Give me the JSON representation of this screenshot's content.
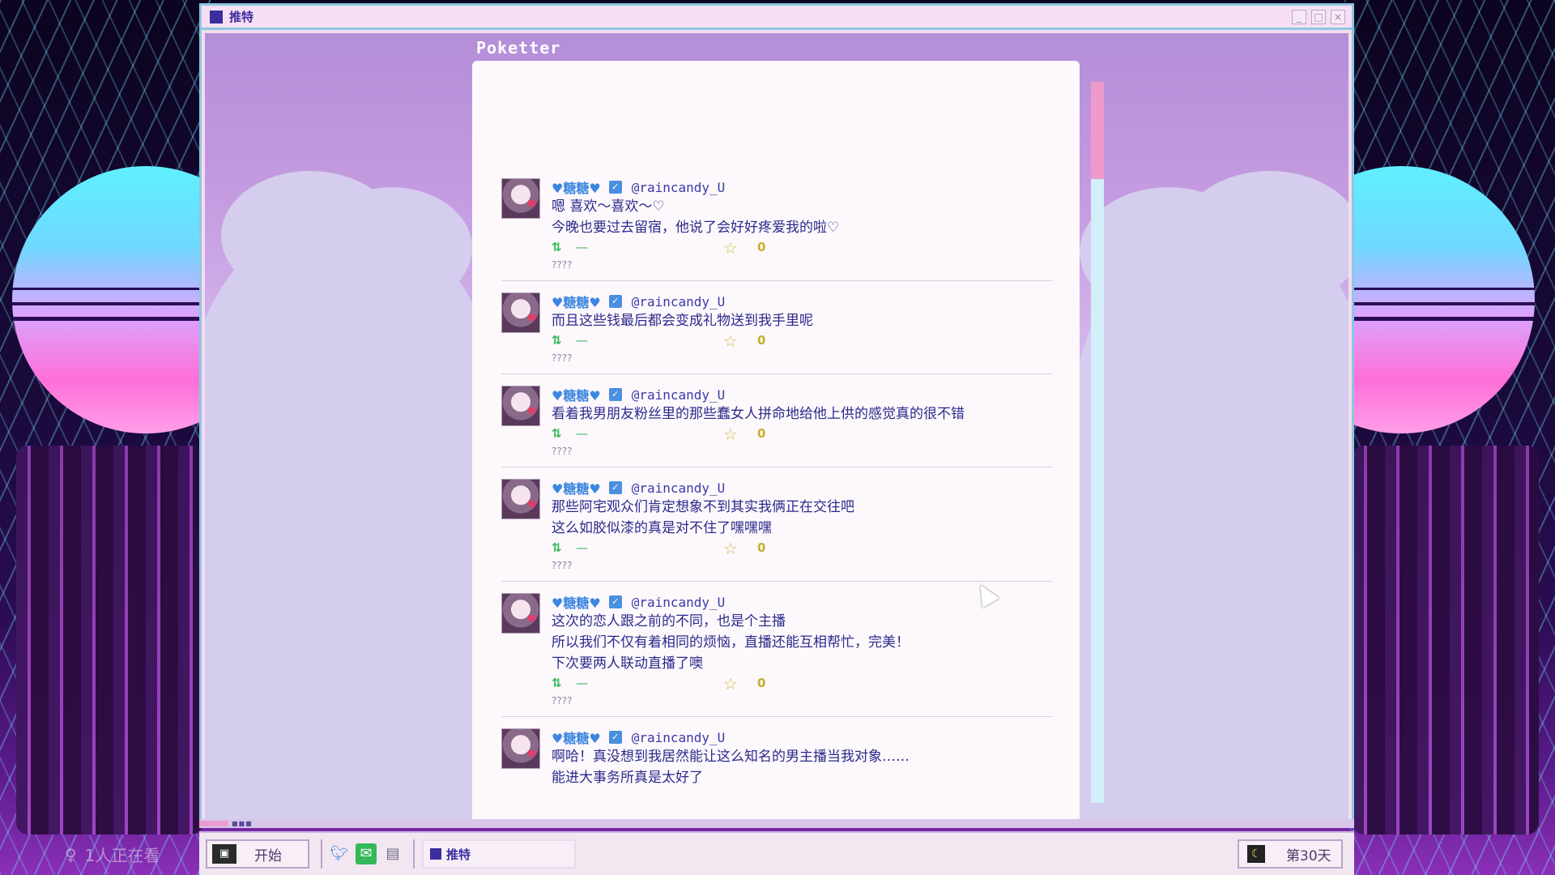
{
  "window": {
    "title": "推特",
    "controls": [
      "_",
      "□",
      "×"
    ]
  },
  "app": {
    "name": "Poketter"
  },
  "posts": [
    {
      "user": "♥糖糖♥",
      "handle": "@raincandy_U",
      "lines": [
        "嗯 喜欢～喜欢～♡",
        "今晚也要过去留宿，他说了会好好疼爱我的啦♡"
      ],
      "retweets": "—",
      "likes": "0",
      "time": "????"
    },
    {
      "user": "♥糖糖♥",
      "handle": "@raincandy_U",
      "lines": [
        "而且这些钱最后都会变成礼物送到我手里呢"
      ],
      "retweets": "—",
      "likes": "0",
      "time": "????"
    },
    {
      "user": "♥糖糖♥",
      "handle": "@raincandy_U",
      "lines": [
        "看着我男朋友粉丝里的那些蠢女人拼命地给他上供的感觉真的很不错"
      ],
      "retweets": "—",
      "likes": "0",
      "time": "????"
    },
    {
      "user": "♥糖糖♥",
      "handle": "@raincandy_U",
      "lines": [
        "那些阿宅观众们肯定想象不到其实我俩正在交往吧",
        "这么如胶似漆的真是对不住了嘿嘿嘿"
      ],
      "retweets": "—",
      "likes": "0",
      "time": "????"
    },
    {
      "user": "♥糖糖♥",
      "handle": "@raincandy_U",
      "lines": [
        "这次的恋人跟之前的不同，也是个主播",
        "所以我们不仅有着相同的烦恼，直播还能互相帮忙，完美！",
        "下次要两人联动直播了噢"
      ],
      "retweets": "—",
      "likes": "0",
      "time": "????"
    },
    {
      "user": "♥糖糖♥",
      "handle": "@raincandy_U",
      "lines": [
        "啊哈！真没想到我居然能让这么知名的男主播当我对象……",
        "能进大事务所真是太好了"
      ],
      "retweets": "—",
      "likes": "0",
      "time": "????"
    }
  ],
  "taskbar": {
    "start_label": "开始",
    "task_label": "推特",
    "day_label": "第30天",
    "quick_launch": [
      "bird-icon",
      "chat-icon",
      "monitor-icon"
    ]
  },
  "overlay": {
    "viewer_count": "1人正在看"
  },
  "colors": {
    "accent": "#3b2ca0",
    "username": "#3b86e0",
    "retweet": "#36b85a",
    "like": "#c6ae2a",
    "scroll_thumb": "#f09acb"
  }
}
